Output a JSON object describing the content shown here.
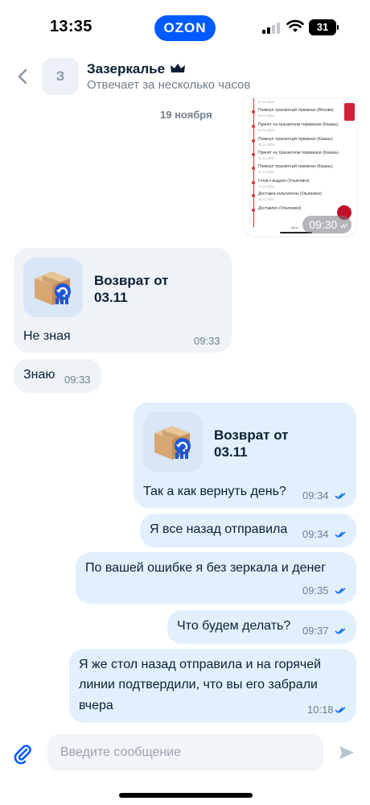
{
  "status_bar": {
    "time": "13:35",
    "app_badge": "OZON",
    "battery": "31"
  },
  "header": {
    "avatar_letter": "З",
    "store_name": "Зазеркалье",
    "store_status": "Отвечает за несколько часов"
  },
  "chat": {
    "date_label": "19 ноября",
    "screenshot": {
      "time": "09:30",
      "tracking": [
        {
          "status": "Покинул транзитный терминал (Москва)",
          "date": "07.11.2025"
        },
        {
          "status": "Принят на транзитном терминале (Казань)",
          "date": "08.11.2025"
        },
        {
          "status": "Покинул транзитный терминал (Казань)",
          "date": "09.11.2025"
        },
        {
          "status": "Принят на транзитном терминале (Казань)",
          "date": "10.11.2025"
        },
        {
          "status": "Покинул транзитный терминал (Казань)",
          "date": "11.11.2025"
        },
        {
          "status": "Готов к выдаче (Ульяновск)",
          "date": "11.11.2025"
        },
        {
          "status": "Доставка получателю (Ульяновск)",
          "date": "12.11.2025"
        },
        {
          "status": "Доставлен (Ульяновск)",
          "date": "13.11.2025"
        }
      ],
      "tab_label": "Чаты"
    },
    "messages": [
      {
        "product_title": "Возврат от 03.11",
        "text": "Не зная",
        "time": "09:33"
      },
      {
        "text": "Знаю",
        "time": "09:33"
      },
      {
        "product_title": "Возврат от 03.11",
        "text": "Так а как вернуть день?",
        "time": "09:34"
      },
      {
        "text": "Я все назад отправила",
        "time": "09:34"
      },
      {
        "text": "По вашей ошибке я без зеркала и денег",
        "time": "09:35"
      },
      {
        "text": "Что будем делать?",
        "time": "09:37"
      },
      {
        "text_lines": [
          "Я же стол назад отправила и на горячей",
          "линии подтвердили, что вы его забрали",
          "вчера"
        ],
        "time": "10:18"
      }
    ]
  },
  "input": {
    "placeholder": "Введите сообщение"
  },
  "colors": {
    "brand": "#005bff",
    "outgoing_bubble": "#e2f0fd",
    "incoming_bubble": "#eff3f8",
    "read_check": "#1a73e8"
  }
}
